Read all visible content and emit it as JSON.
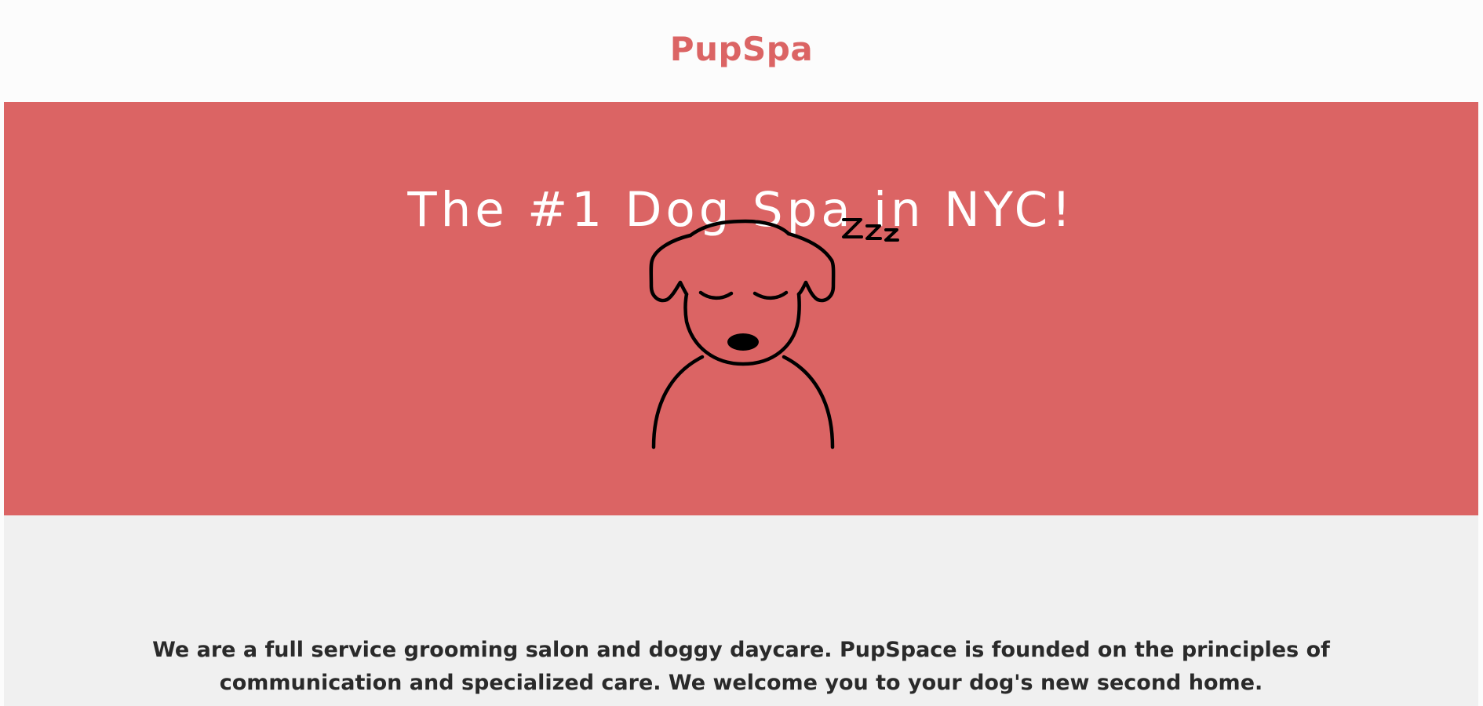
{
  "header": {
    "brand": "PupSpa"
  },
  "hero": {
    "title": "The #1 Dog Spa in NYC!",
    "illustration_icon": "sleeping-dog-icon",
    "background_color": "#db6464",
    "title_color": "#ffffff"
  },
  "about": {
    "text": "We are a full service grooming salon and doggy daycare. PupSpace is founded on the principles of communication and specialized care. We welcome you to your dog's new second home.",
    "background_color": "#f0f0f0"
  },
  "colors": {
    "brand": "#db6464",
    "page_background": "#fcfcfc",
    "text_dark": "#2a2a2a"
  }
}
